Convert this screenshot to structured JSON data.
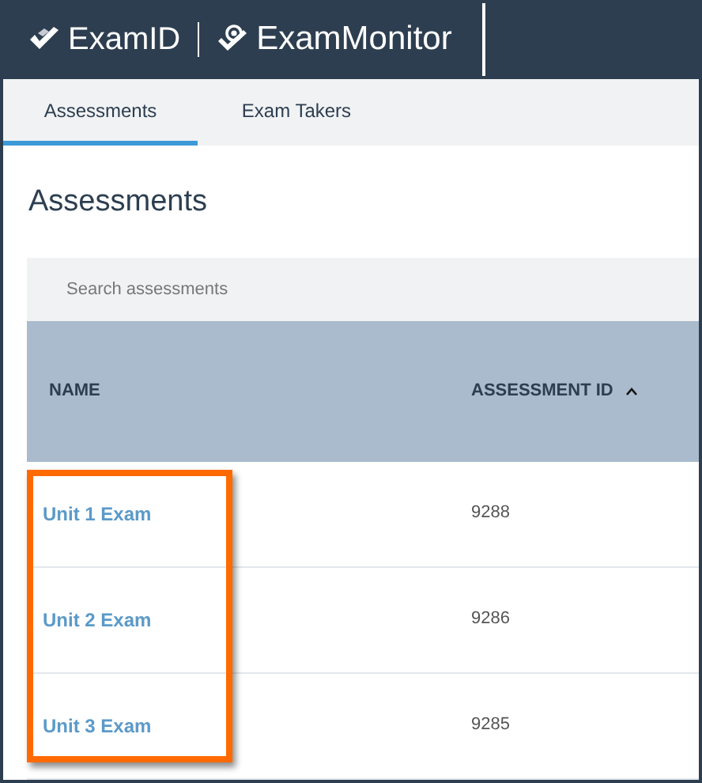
{
  "header": {
    "brands": [
      "ExamID",
      "ExamMonitor"
    ]
  },
  "tabs": [
    {
      "label": "Assessments",
      "selected": true
    },
    {
      "label": "Exam Takers",
      "selected": false
    }
  ],
  "page_title": "Assessments",
  "search": {
    "placeholder": "Search assessments"
  },
  "table": {
    "columns": [
      {
        "label": "NAME",
        "sorted": false
      },
      {
        "label": "ASSESSMENT ID",
        "sorted": true
      }
    ],
    "rows": [
      {
        "name": "Unit 1 Exam",
        "id": "9288"
      },
      {
        "name": "Unit 2 Exam",
        "id": "9286"
      },
      {
        "name": "Unit 3 Exam",
        "id": "9285"
      }
    ]
  }
}
